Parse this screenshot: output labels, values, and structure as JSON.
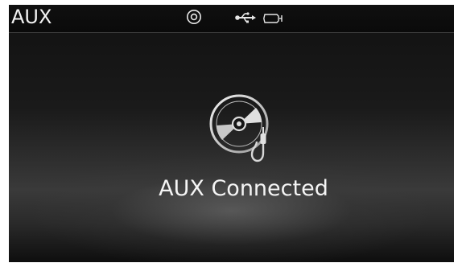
{
  "header": {
    "title": "AUX",
    "icons": [
      "disc-icon",
      "usb-icon",
      "battery-icon"
    ]
  },
  "main": {
    "icon": "cd-aux-cable-icon",
    "message": "AUX Connected"
  },
  "colors": {
    "text": "#f2f2f2",
    "background": "#111111",
    "icon": "#dddddd"
  }
}
